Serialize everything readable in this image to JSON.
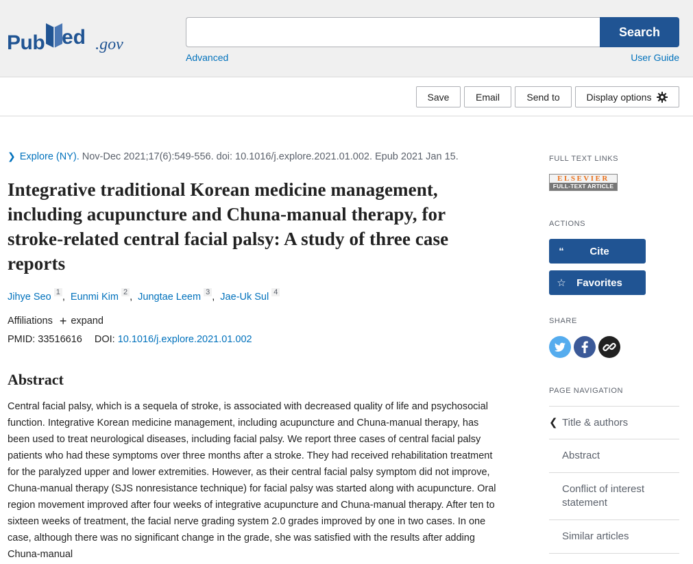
{
  "header": {
    "logo_pub": "Pub",
    "logo_med": "Med",
    "logo_gov": ".gov",
    "search_placeholder": "",
    "search_label": "Search",
    "advanced_label": "Advanced",
    "user_guide_label": "User Guide"
  },
  "toolbar": {
    "save_label": "Save",
    "email_label": "Email",
    "send_to_label": "Send to",
    "display_options_label": "Display options"
  },
  "article": {
    "journal": "Explore (NY).",
    "citation": "Nov-Dec 2021;17(6):549-556. doi: 10.1016/j.explore.2021.01.002. Epub 2021 Jan 15.",
    "title": "Integrative traditional Korean medicine management, including acupuncture and Chuna-manual therapy, for stroke-related central facial palsy: A study of three case reports",
    "authors": [
      {
        "name": "Jihye Seo",
        "sup": "1"
      },
      {
        "name": "Eunmi Kim",
        "sup": "2"
      },
      {
        "name": "Jungtae Leem",
        "sup": "3"
      },
      {
        "name": "Jae-Uk Sul",
        "sup": "4"
      }
    ],
    "affiliations_label": "Affiliations",
    "expand_label": "expand",
    "pmid_label": "PMID: 33516616",
    "doi_label": "DOI:",
    "doi_value": "10.1016/j.explore.2021.01.002",
    "abstract_heading": "Abstract",
    "abstract_text": "Central facial palsy, which is a sequela of stroke, is associated with decreased quality of life and psychosocial function. Integrative Korean medicine management, including acupuncture and Chuna-manual therapy, has been used to treat neurological diseases, including facial palsy. We report three cases of central facial palsy patients who had these symptoms over three months after a stroke. They had received rehabilitation treatment for the paralyzed upper and lower extremities. However, as their central facial palsy symptom did not improve, Chuna-manual therapy (SJS nonresistance technique) for facial palsy was started along with acupuncture. Oral region movement improved after four weeks of integrative acupuncture and Chuna-manual therapy. After ten to sixteen weeks of treatment, the facial nerve grading system 2.0 grades improved by one in two cases. In one case, although there was no significant change in the grade, she was satisfied with the results after adding Chuna-manual"
  },
  "sidebar": {
    "full_text_links_label": "FULL TEXT LINKS",
    "elsevier_top": "ELSEVIER",
    "elsevier_bottom": "FULL-TEXT ARTICLE",
    "actions_label": "ACTIONS",
    "cite_label": "Cite",
    "favorites_label": "Favorites",
    "share_label": "SHARE",
    "page_navigation_label": "PAGE NAVIGATION",
    "nav_items": [
      {
        "label": "Title & authors"
      },
      {
        "label": "Abstract"
      },
      {
        "label": "Conflict of interest statement"
      },
      {
        "label": "Similar articles"
      }
    ]
  },
  "colors": {
    "brand_blue": "#205493",
    "link_blue": "#0071bc",
    "twitter": "#55acee",
    "facebook": "#3b5998",
    "permalink": "#212121"
  }
}
